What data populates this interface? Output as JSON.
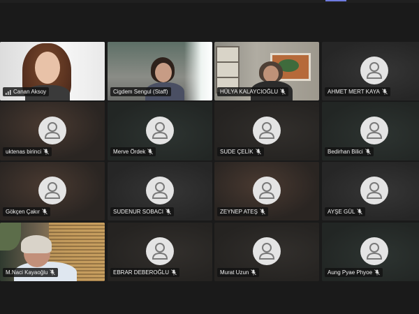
{
  "participants": [
    {
      "name": "Canan Aksoy",
      "indicator": "signal-bars-icon"
    },
    {
      "name": "Cigdem Sengul (Staff)",
      "active": true
    },
    {
      "name": "HÜLYA KALAYCIOĞLU",
      "muted": true
    },
    {
      "name": "AHMET MERT KAYA",
      "muted": true
    },
    {
      "name": "uktenas birinci",
      "muted": true
    },
    {
      "name": "Merve Ördek",
      "muted": true
    },
    {
      "name": "SUDE ÇELİK",
      "muted": true
    },
    {
      "name": "Bedirhan Bilici",
      "muted": true
    },
    {
      "name": "Gökçen Çakır",
      "muted": true
    },
    {
      "name": "SUDENUR SOBACI",
      "muted": true
    },
    {
      "name": "ZEYNEP ATEŞ",
      "muted": true
    },
    {
      "name": "AYŞE GÜL",
      "muted": true
    },
    {
      "name": "M.Naci Kayaoğlu",
      "muted": true
    },
    {
      "name": "EBRAR DEBEROĞLU",
      "muted": true
    },
    {
      "name": "Murat Uzun",
      "muted": true
    },
    {
      "name": "Aung Pyae Phyoe",
      "muted": true
    }
  ],
  "colors": {
    "active_outline": "#8b86e8",
    "avatar": "#e4e4e4",
    "background": "#1a1a1a"
  }
}
